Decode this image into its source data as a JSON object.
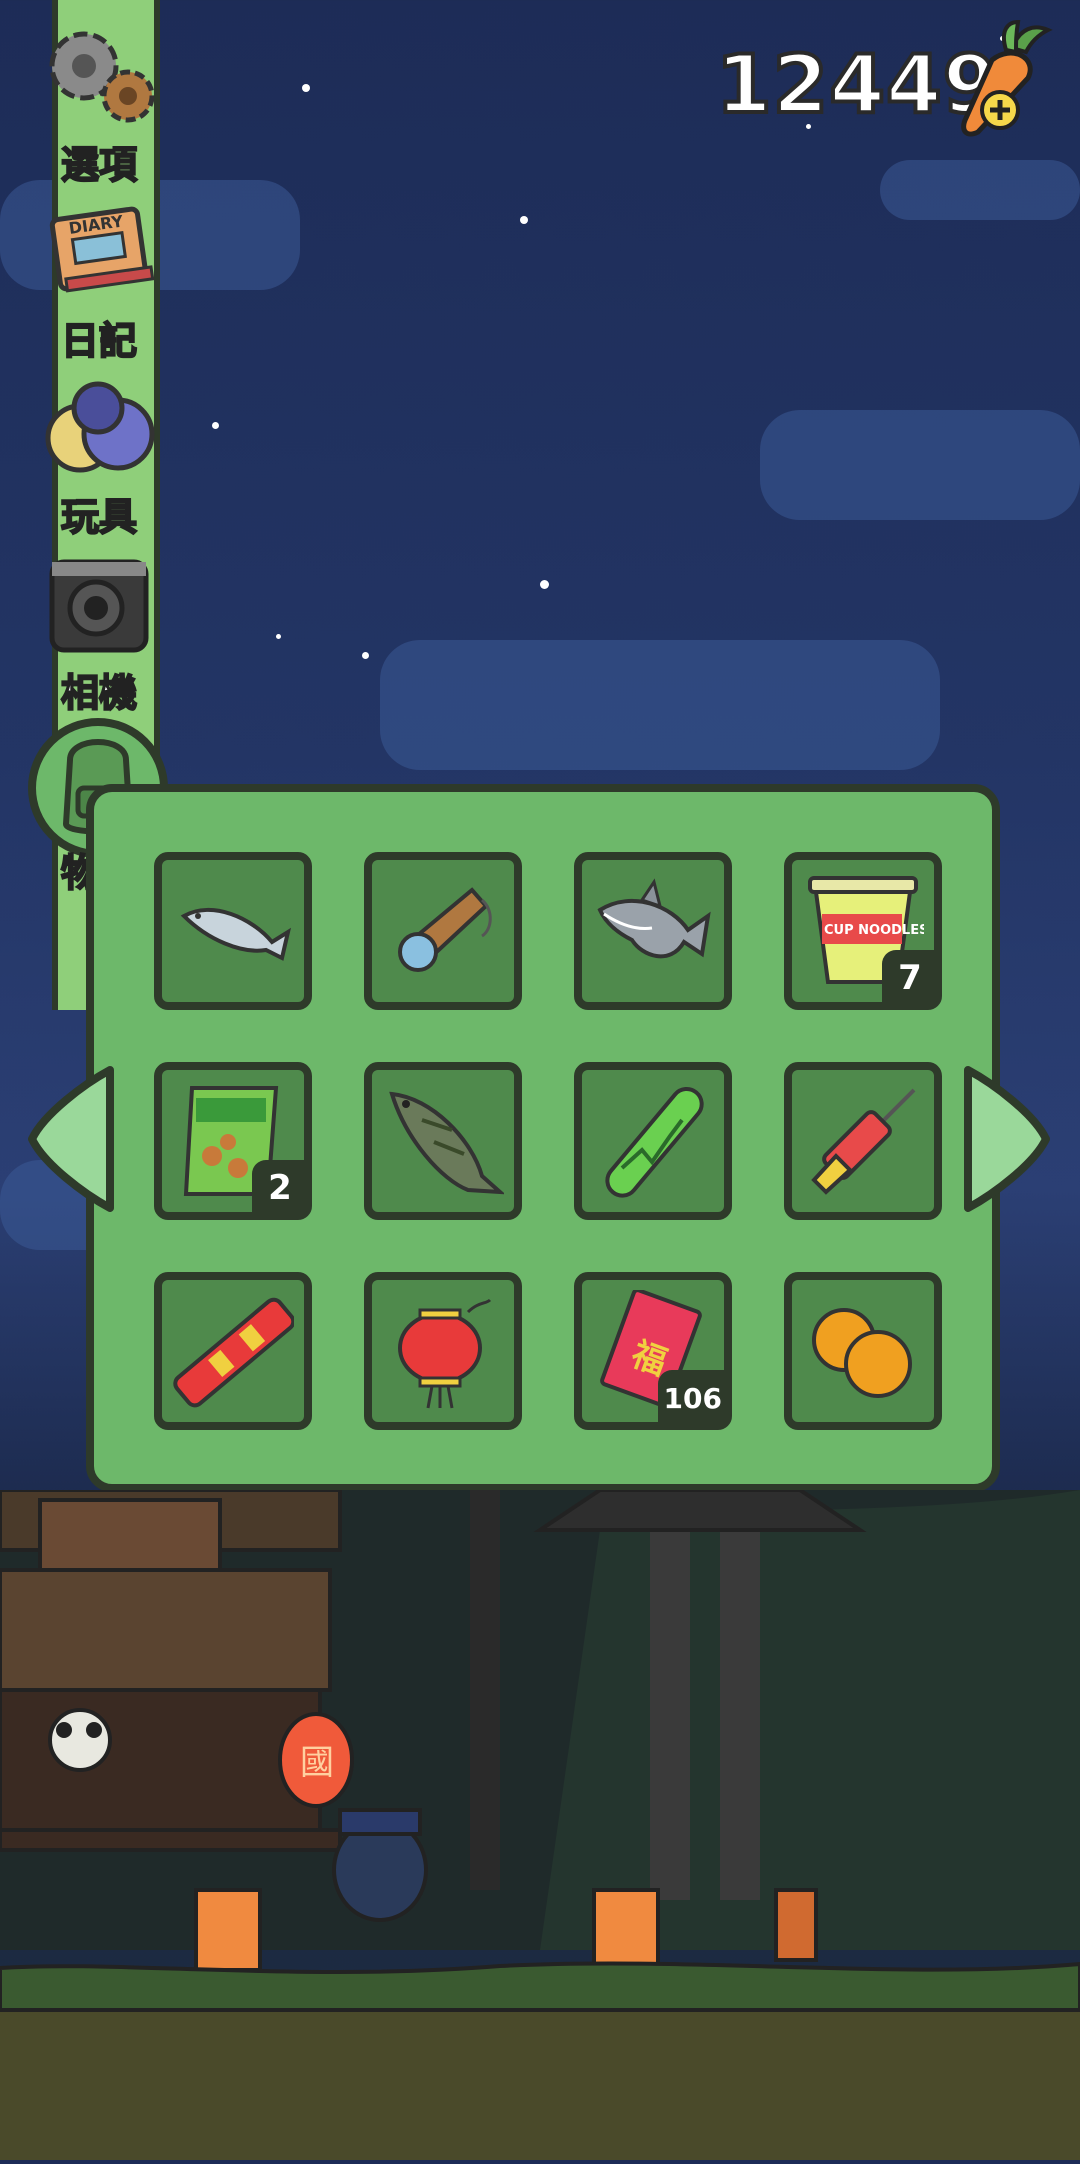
{
  "currency": {
    "amount": "12449",
    "add_icon": "carrot-plus-icon"
  },
  "side_menu": {
    "items": [
      {
        "label": "選項",
        "icon": "gear-icon"
      },
      {
        "label": "日記",
        "icon": "diary-icon"
      },
      {
        "label": "玩具",
        "icon": "toy-balls-icon"
      },
      {
        "label": "相機",
        "icon": "camera-icon"
      },
      {
        "label": "物品",
        "icon": "backpack-icon"
      }
    ]
  },
  "inventory": {
    "items": [
      {
        "name": "sardine",
        "icon": "small-fish-icon",
        "count": ""
      },
      {
        "name": "spyglass",
        "icon": "telescope-icon",
        "count": ""
      },
      {
        "name": "shark",
        "icon": "shark-icon",
        "count": ""
      },
      {
        "name": "cup noodles",
        "icon": "cup-noodles-icon",
        "count": "7"
      },
      {
        "name": "snack bag",
        "icon": "snack-bag-icon",
        "count": "2"
      },
      {
        "name": "bass fish",
        "icon": "bass-fish-icon",
        "count": ""
      },
      {
        "name": "cucumber stick",
        "icon": "green-stick-icon",
        "count": ""
      },
      {
        "name": "rocket firework",
        "icon": "rocket-icon",
        "count": ""
      },
      {
        "name": "firecracker",
        "icon": "firecracker-icon",
        "count": ""
      },
      {
        "name": "red lantern",
        "icon": "lantern-icon",
        "count": ""
      },
      {
        "name": "red envelope",
        "icon": "red-envelope-icon",
        "count": "106",
        "envelope_text": "福"
      },
      {
        "name": "mandarin oranges",
        "icon": "oranges-icon",
        "count": ""
      }
    ],
    "prev_icon": "arrow-left-icon",
    "next_icon": "arrow-right-icon"
  },
  "scene": {
    "cup_text": "CUP NOODLES",
    "diary_text": "DIARY",
    "lantern_text": "國"
  }
}
